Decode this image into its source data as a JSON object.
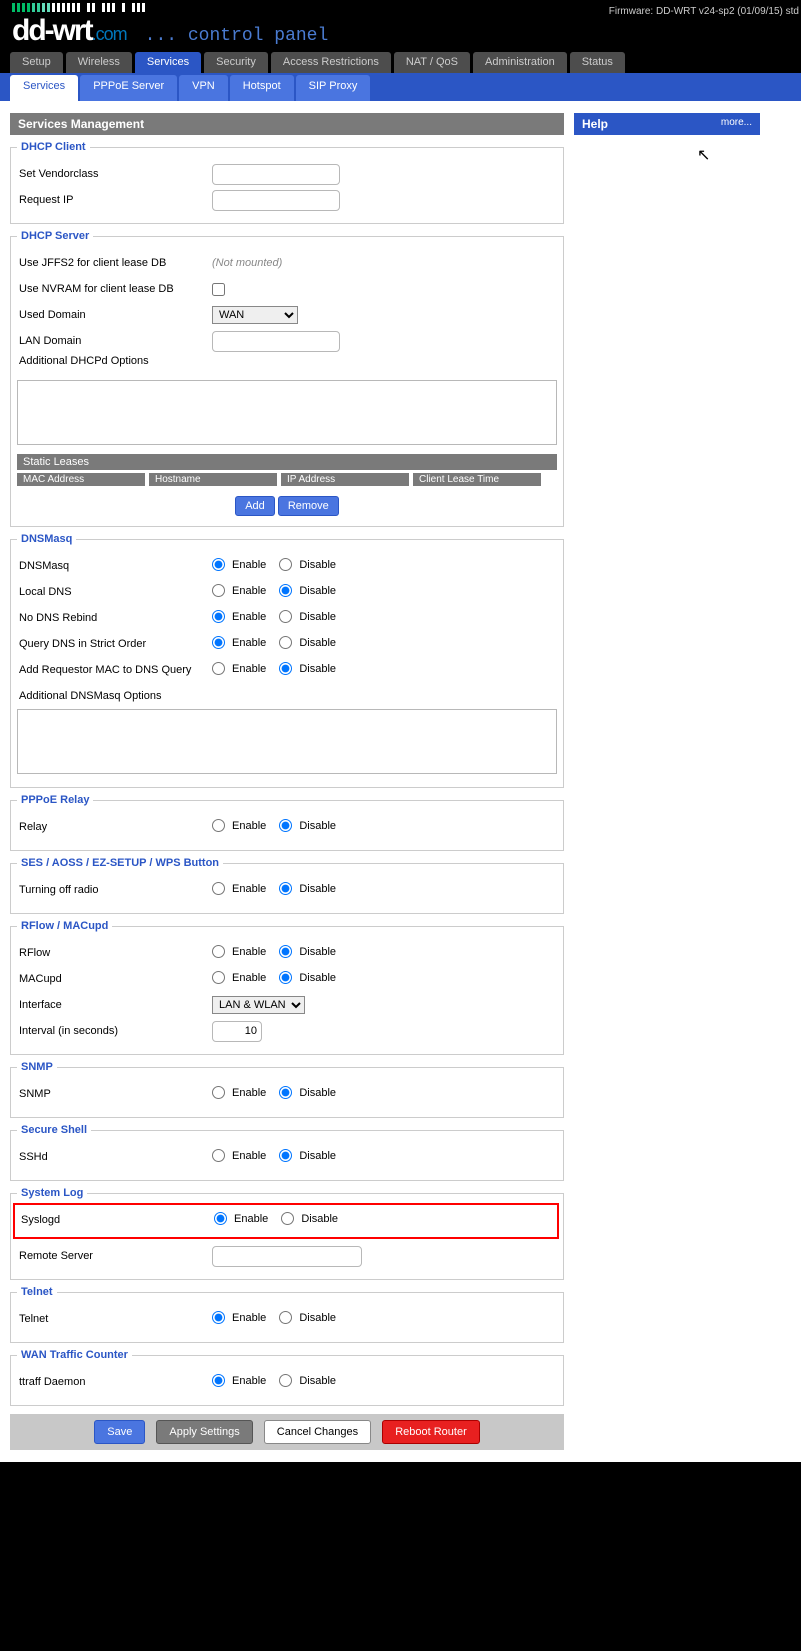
{
  "firmware": "Firmware: DD-WRT v24-sp2 (01/09/15) std",
  "logo": {
    "dd": "dd-wrt",
    "com": ".com",
    "cp": "... control panel"
  },
  "tabs": [
    "Setup",
    "Wireless",
    "Services",
    "Security",
    "Access Restrictions",
    "NAT / QoS",
    "Administration",
    "Status"
  ],
  "tabs_active": 2,
  "subtabs": [
    "Services",
    "PPPoE Server",
    "VPN",
    "Hotspot",
    "SIP Proxy"
  ],
  "subtabs_active": 0,
  "section_title": "Services Management",
  "help": {
    "title": "Help",
    "more": "more..."
  },
  "radio": {
    "enable": "Enable",
    "disable": "Disable"
  },
  "dhcp_client": {
    "legend": "DHCP Client",
    "vendorclass_label": "Set Vendorclass",
    "vendorclass_value": "",
    "requestip_label": "Request IP",
    "requestip_value": ""
  },
  "dhcp_server": {
    "legend": "DHCP Server",
    "jffs2_label": "Use JFFS2 for client lease DB",
    "jffs2_note": "(Not mounted)",
    "nvram_label": "Use NVRAM for client lease DB",
    "nvram_checked": false,
    "domain_label": "Used Domain",
    "domain_value": "WAN",
    "lan_domain_label": "LAN Domain",
    "lan_domain_value": "",
    "addl_label": "Additional DHCPd Options",
    "addl_value": "",
    "static_leases": "Static Leases",
    "cols": [
      "MAC Address",
      "Hostname",
      "IP Address",
      "Client Lease Time"
    ],
    "add": "Add",
    "remove": "Remove"
  },
  "dnsmasq": {
    "legend": "DNSMasq",
    "rows": [
      {
        "label": "DNSMasq",
        "sel": "enable"
      },
      {
        "label": "Local DNS",
        "sel": "disable"
      },
      {
        "label": "No DNS Rebind",
        "sel": "enable"
      },
      {
        "label": "Query DNS in Strict Order",
        "sel": "enable"
      },
      {
        "label": "Add Requestor MAC to DNS Query",
        "sel": "disable"
      }
    ],
    "addl_label": "Additional DNSMasq Options",
    "addl_value": ""
  },
  "pppoe_relay": {
    "legend": "PPPoE Relay",
    "label": "Relay",
    "sel": "disable"
  },
  "ses": {
    "legend": "SES / AOSS / EZ-SETUP / WPS Button",
    "label": "Turning off radio",
    "sel": "disable"
  },
  "rflow": {
    "legend": "RFlow / MACupd",
    "rflow_label": "RFlow",
    "rflow_sel": "disable",
    "macupd_label": "MACupd",
    "macupd_sel": "disable",
    "iface_label": "Interface",
    "iface_value": "LAN & WLAN",
    "interval_label": "Interval (in seconds)",
    "interval_value": "10"
  },
  "snmp": {
    "legend": "SNMP",
    "label": "SNMP",
    "sel": "disable"
  },
  "ssh": {
    "legend": "Secure Shell",
    "label": "SSHd",
    "sel": "disable"
  },
  "syslog": {
    "legend": "System Log",
    "label": "Syslogd",
    "sel": "enable",
    "remote_label": "Remote Server",
    "remote_value": ""
  },
  "telnet": {
    "legend": "Telnet",
    "label": "Telnet",
    "sel": "enable"
  },
  "wan_traffic": {
    "legend": "WAN Traffic Counter",
    "label": "ttraff Daemon",
    "sel": "enable"
  },
  "footer": {
    "save": "Save",
    "apply": "Apply Settings",
    "cancel": "Cancel Changes",
    "reboot": "Reboot Router"
  }
}
